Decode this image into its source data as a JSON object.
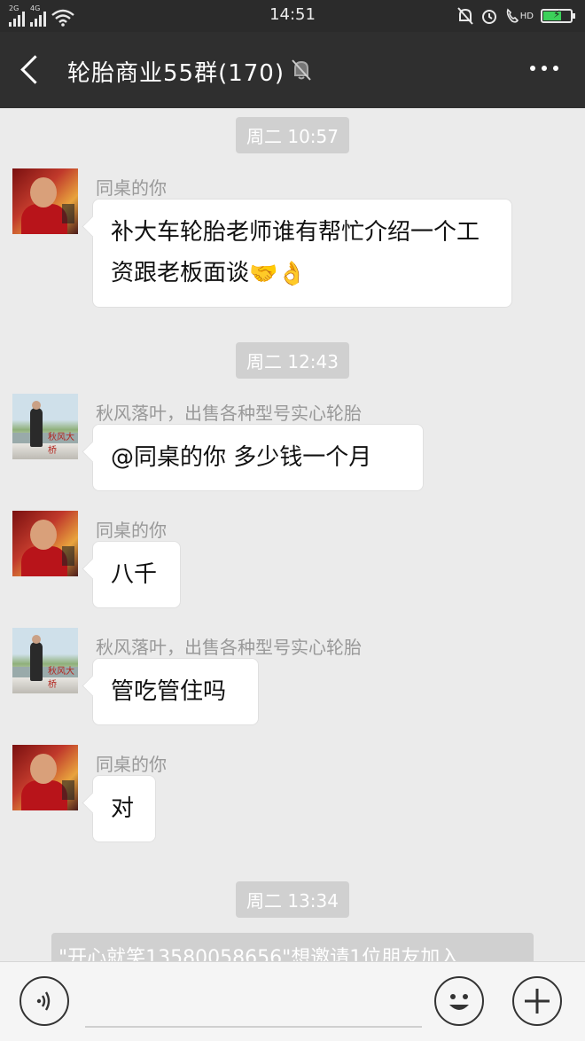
{
  "status_bar": {
    "network_left": "2G",
    "network_right": "4G",
    "time": "14:51",
    "hd_label": "HD",
    "battery_fill_pct": 65
  },
  "header": {
    "title": "轮胎商业55群(170)"
  },
  "messages": [
    {
      "type": "time",
      "text": "周二 10:57"
    },
    {
      "type": "msg",
      "sender": "同桌的你",
      "text": "补大车轮胎老师谁有帮忙介绍一个工资跟老板面谈",
      "emoji": "🤝👌"
    },
    {
      "type": "time",
      "text": "周二 12:43"
    },
    {
      "type": "msg",
      "sender": "秋风落叶，出售各种型号实心轮胎",
      "text": "@同桌的你  多少钱一个月"
    },
    {
      "type": "msg",
      "sender": "同桌的你",
      "text": "八千"
    },
    {
      "type": "msg",
      "sender": "秋风落叶，出售各种型号实心轮胎",
      "text": "管吃管住吗"
    },
    {
      "type": "msg",
      "sender": "同桌的你",
      "text": "对"
    },
    {
      "type": "time",
      "text": "周二 13:34"
    },
    {
      "type": "system",
      "text": "\"开心就笑13580058656\"想邀请1位朋友加入"
    }
  ],
  "input": {
    "placeholder": ""
  },
  "avatar_watermark": "秋风大桥"
}
